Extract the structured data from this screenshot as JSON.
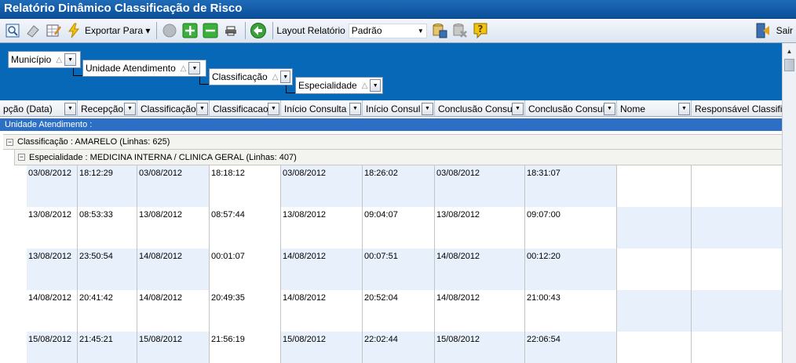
{
  "window": {
    "title": "Relatório Dinâmico Classificação de Risco"
  },
  "toolbar": {
    "icons": [
      "preview-icon",
      "eraser-icon",
      "edit-grid-icon",
      "export-icon",
      "circle-icon",
      "add-icon",
      "remove-icon",
      "print-layout-icon",
      "back-icon",
      "save-layout-icon",
      "delete-layout-icon",
      "help-icon",
      "exit-icon"
    ],
    "export_label": "Exportar Para",
    "layout_label": "Layout Relatório",
    "layout_value": "Padrão",
    "exit_label": "Sair"
  },
  "group_panel": {
    "groups": [
      "Município",
      "Unidade Atendimento",
      "Classificação",
      "Especialidade"
    ]
  },
  "columns": [
    "pção (Data)",
    "Recepção",
    "Classificação",
    "Classificacao",
    "Início Consulta",
    "Início Consul",
    "Conclusão Consu",
    "Conclusão Consul",
    "Nome",
    "Responsável Classific"
  ],
  "bands": {
    "level0": "Unidade Atendimento :",
    "level1": "Classificação : AMARELO (Linhas: 625)",
    "level2": "Especialidade : MEDICINA INTERNA / CLINICA GERAL (Linhas: 407)"
  },
  "rows": [
    [
      "03/08/2012",
      "18:12:29",
      "03/08/2012",
      "18:18:12",
      "03/08/2012",
      "18:26:02",
      "03/08/2012",
      "18:31:07",
      "",
      ""
    ],
    [
      "13/08/2012",
      "08:53:33",
      "13/08/2012",
      "08:57:44",
      "13/08/2012",
      "09:04:07",
      "13/08/2012",
      "09:07:00",
      "",
      ""
    ],
    [
      "13/08/2012",
      "23:50:54",
      "14/08/2012",
      "00:01:07",
      "14/08/2012",
      "00:07:51",
      "14/08/2012",
      "00:12:20",
      "",
      ""
    ],
    [
      "14/08/2012",
      "20:41:42",
      "14/08/2012",
      "20:49:35",
      "14/08/2012",
      "20:52:04",
      "14/08/2012",
      "21:00:43",
      "",
      ""
    ],
    [
      "15/08/2012",
      "21:45:21",
      "15/08/2012",
      "21:56:19",
      "15/08/2012",
      "22:02:44",
      "15/08/2012",
      "22:06:54",
      "",
      ""
    ]
  ]
}
